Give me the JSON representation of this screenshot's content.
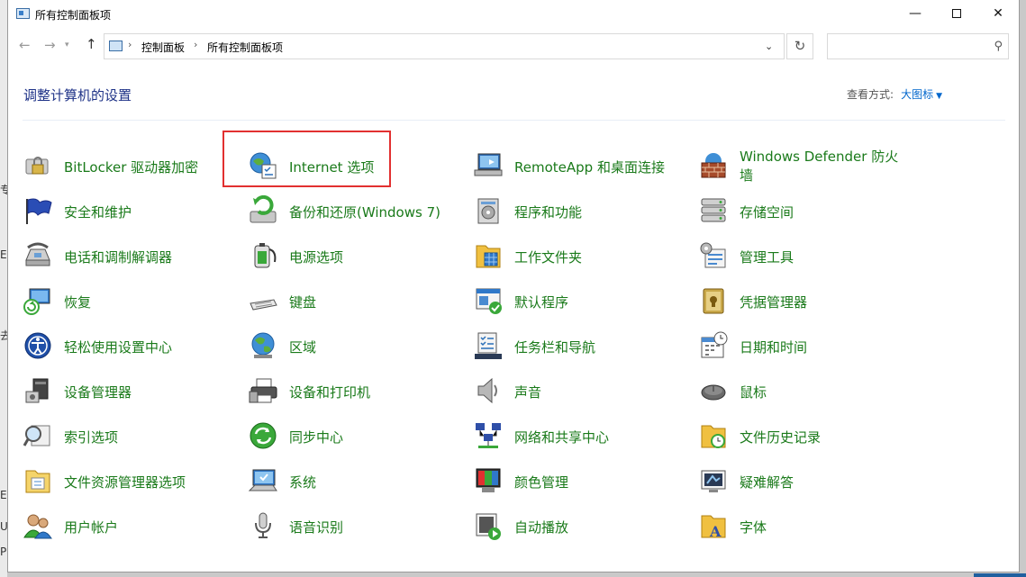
{
  "window": {
    "title": "所有控制面板项",
    "controls": {
      "minimize": "—",
      "close": "✕"
    }
  },
  "navbar": {
    "back": "←",
    "forward": "→",
    "recent": "▾",
    "up": "↑",
    "breadcrumb": [
      "控制面板",
      "所有控制面板项"
    ],
    "separator": "›",
    "address_dropdown": "⌄",
    "refresh": "↻",
    "search_placeholder": "",
    "search_glyph": "⚲"
  },
  "header": {
    "title": "调整计算机的设置",
    "view_label": "查看方式:",
    "view_value": "大图标",
    "view_caret": "▼"
  },
  "background_fragments": [
    "专",
    "E",
    "去",
    "E",
    "U",
    "P"
  ],
  "items": [
    {
      "label": "BitLocker 驱动器加密",
      "icon": "bitlocker-icon"
    },
    {
      "label": "Internet 选项",
      "icon": "internet-options-icon"
    },
    {
      "label": "RemoteApp 和桌面连接",
      "icon": "remoteapp-icon"
    },
    {
      "label": "Windows Defender 防火墙",
      "icon": "firewall-icon"
    },
    {
      "label": "安全和维护",
      "icon": "security-flag-icon"
    },
    {
      "label": "备份和还原(Windows 7)",
      "icon": "backup-icon"
    },
    {
      "label": "程序和功能",
      "icon": "programs-icon"
    },
    {
      "label": "存储空间",
      "icon": "storage-icon"
    },
    {
      "label": "电话和调制解调器",
      "icon": "phone-modem-icon"
    },
    {
      "label": "电源选项",
      "icon": "power-icon"
    },
    {
      "label": "工作文件夹",
      "icon": "work-folders-icon"
    },
    {
      "label": "管理工具",
      "icon": "admin-tools-icon"
    },
    {
      "label": "恢复",
      "icon": "recovery-icon"
    },
    {
      "label": "键盘",
      "icon": "keyboard-icon"
    },
    {
      "label": "默认程序",
      "icon": "default-programs-icon"
    },
    {
      "label": "凭据管理器",
      "icon": "credential-icon"
    },
    {
      "label": "轻松使用设置中心",
      "icon": "ease-of-access-icon"
    },
    {
      "label": "区域",
      "icon": "region-icon"
    },
    {
      "label": "任务栏和导航",
      "icon": "taskbar-icon"
    },
    {
      "label": "日期和时间",
      "icon": "date-time-icon"
    },
    {
      "label": "设备管理器",
      "icon": "device-manager-icon"
    },
    {
      "label": "设备和打印机",
      "icon": "printer-icon"
    },
    {
      "label": "声音",
      "icon": "sound-icon"
    },
    {
      "label": "鼠标",
      "icon": "mouse-icon"
    },
    {
      "label": "索引选项",
      "icon": "indexing-icon"
    },
    {
      "label": "同步中心",
      "icon": "sync-icon"
    },
    {
      "label": "网络和共享中心",
      "icon": "network-icon"
    },
    {
      "label": "文件历史记录",
      "icon": "file-history-icon"
    },
    {
      "label": "文件资源管理器选项",
      "icon": "explorer-options-icon"
    },
    {
      "label": "系统",
      "icon": "system-icon"
    },
    {
      "label": "颜色管理",
      "icon": "color-management-icon"
    },
    {
      "label": "疑难解答",
      "icon": "troubleshooting-icon"
    },
    {
      "label": "用户帐户",
      "icon": "user-accounts-icon"
    },
    {
      "label": "语音识别",
      "icon": "speech-icon"
    },
    {
      "label": "自动播放",
      "icon": "autoplay-icon"
    },
    {
      "label": "字体",
      "icon": "fonts-icon"
    }
  ],
  "colors": {
    "link_green": "#1a7a1a",
    "header_blue": "#1e3287",
    "highlight_red": "#e23030"
  }
}
